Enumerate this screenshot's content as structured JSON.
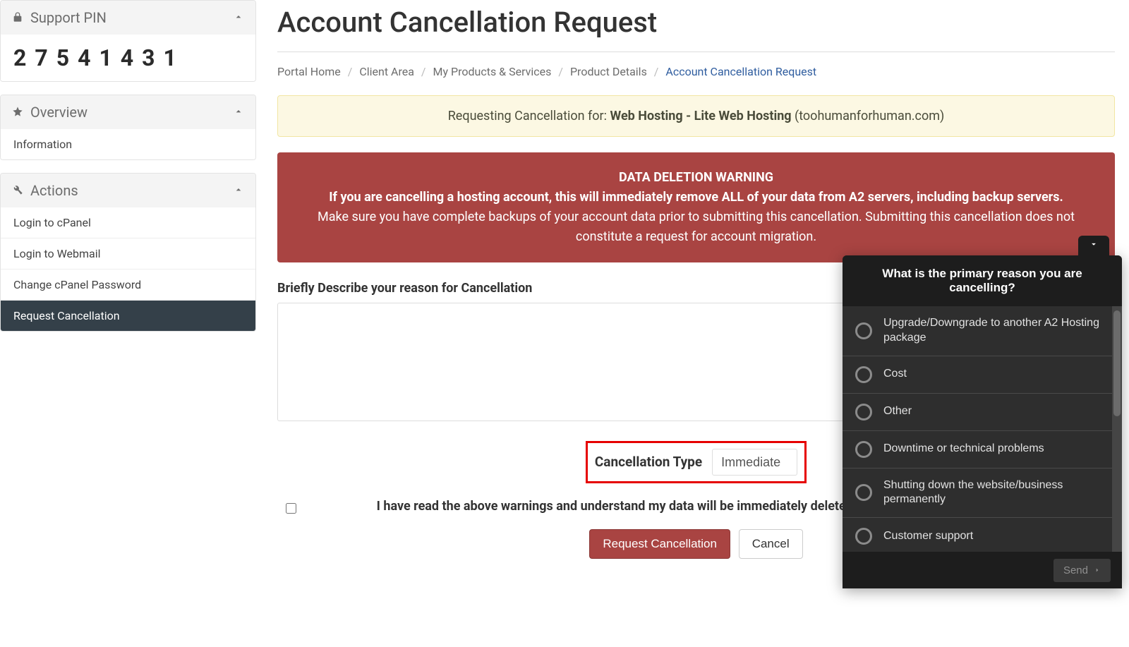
{
  "sidebar": {
    "support_pin": {
      "title": "Support PIN",
      "value": "27541431"
    },
    "overview": {
      "title": "Overview",
      "items": [
        "Information"
      ]
    },
    "actions": {
      "title": "Actions",
      "items": [
        {
          "label": "Login to cPanel",
          "active": false
        },
        {
          "label": "Login to Webmail",
          "active": false
        },
        {
          "label": "Change cPanel Password",
          "active": false
        },
        {
          "label": "Request Cancellation",
          "active": true
        }
      ]
    }
  },
  "page": {
    "title": "Account Cancellation Request",
    "breadcrumb": {
      "items": [
        "Portal Home",
        "Client Area",
        "My Products & Services",
        "Product Details"
      ],
      "current": "Account Cancellation Request"
    },
    "info_alert": {
      "prefix": "Requesting Cancellation for: ",
      "product": "Web Hosting - Lite Web Hosting",
      "domain": " (toohumanforhuman.com)"
    },
    "warning": {
      "header": "DATA DELETION WARNING",
      "line1": "If you are cancelling a hosting account, this will immediately remove ALL of your data from A2 servers, including backup servers.",
      "line2": "Make sure you have complete backups of your account data prior to submitting this cancellation. Submitting this cancellation does not constitute a request for account migration."
    },
    "form": {
      "reason_label": "Briefly Describe your reason for Cancellation",
      "reason_value": "",
      "cancel_type_label": "Cancellation Type",
      "cancel_type_value": "Immediate",
      "confirm_text": "I have read the above warnings and understand my data will be immediately deleted upon completion of cancellation.",
      "submit_label": "Request Cancellation",
      "cancel_label": "Cancel"
    }
  },
  "survey": {
    "question": "What is the primary reason you are cancelling?",
    "options": [
      "Upgrade/Downgrade to another A2 Hosting package",
      "Cost",
      "Other",
      "Downtime or technical problems",
      "Shutting down the website/business permanently",
      "Customer support"
    ],
    "send_label": "Send"
  }
}
